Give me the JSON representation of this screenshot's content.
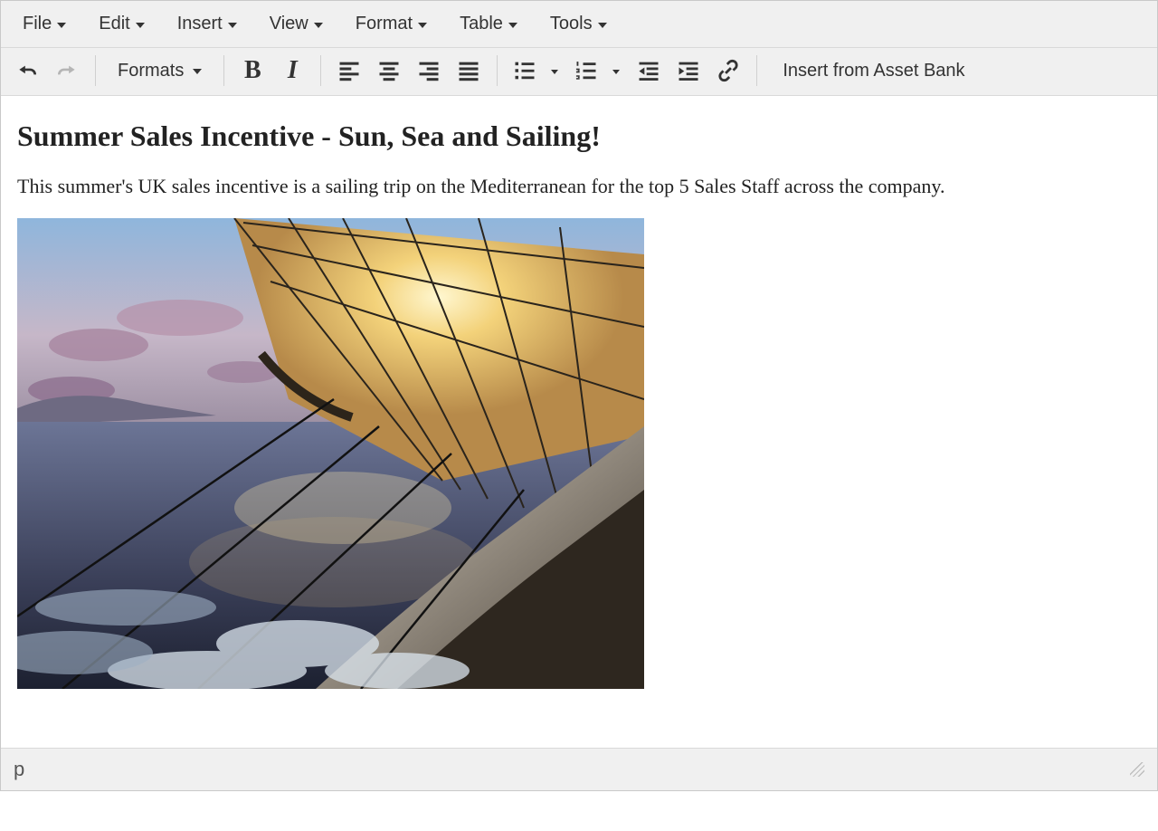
{
  "menubar": {
    "items": [
      {
        "label": "File"
      },
      {
        "label": "Edit"
      },
      {
        "label": "Insert"
      },
      {
        "label": "View"
      },
      {
        "label": "Format"
      },
      {
        "label": "Table"
      },
      {
        "label": "Tools"
      }
    ]
  },
  "toolbar": {
    "formats_label": "Formats",
    "asset_bank_label": "Insert from Asset Bank"
  },
  "content": {
    "heading": "Summer Sales Incentive - Sun, Sea and Sailing!",
    "paragraph": "This summer's UK sales incentive is a sailing trip on the Mediterranean for the top 5 Sales Staff across the company.",
    "image_alt": "Sailboat at sea with sun behind the sail"
  },
  "statusbar": {
    "path": "p"
  }
}
